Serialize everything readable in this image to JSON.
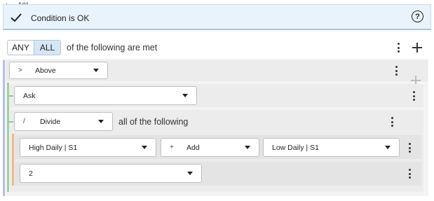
{
  "top_tab": {
    "plus": "+",
    "label": "Add"
  },
  "status": {
    "message": "Condition is OK",
    "help_glyph": "?"
  },
  "match": {
    "any_label": "ANY",
    "all_label": "ALL",
    "active": "ALL",
    "suffix": "of the following are met"
  },
  "rows": {
    "above": {
      "symbol": ">",
      "value": "Above"
    },
    "ask": {
      "value": "Ask"
    },
    "divide": {
      "symbol": "/",
      "value": "Divide",
      "suffix": "all of the following"
    },
    "high": {
      "value": "High Daily | S1"
    },
    "add_op": {
      "symbol": "+",
      "value": "Add"
    },
    "low": {
      "value": "Low Daily | S1"
    },
    "two": {
      "value": "2"
    }
  },
  "colors": {
    "status_bg": "#e9f3fb",
    "active_toggle": "#d5e6f7",
    "rail_blue": "#b9bde8",
    "rail_green": "#9fd09f",
    "rail_orange": "#f0b78c"
  }
}
